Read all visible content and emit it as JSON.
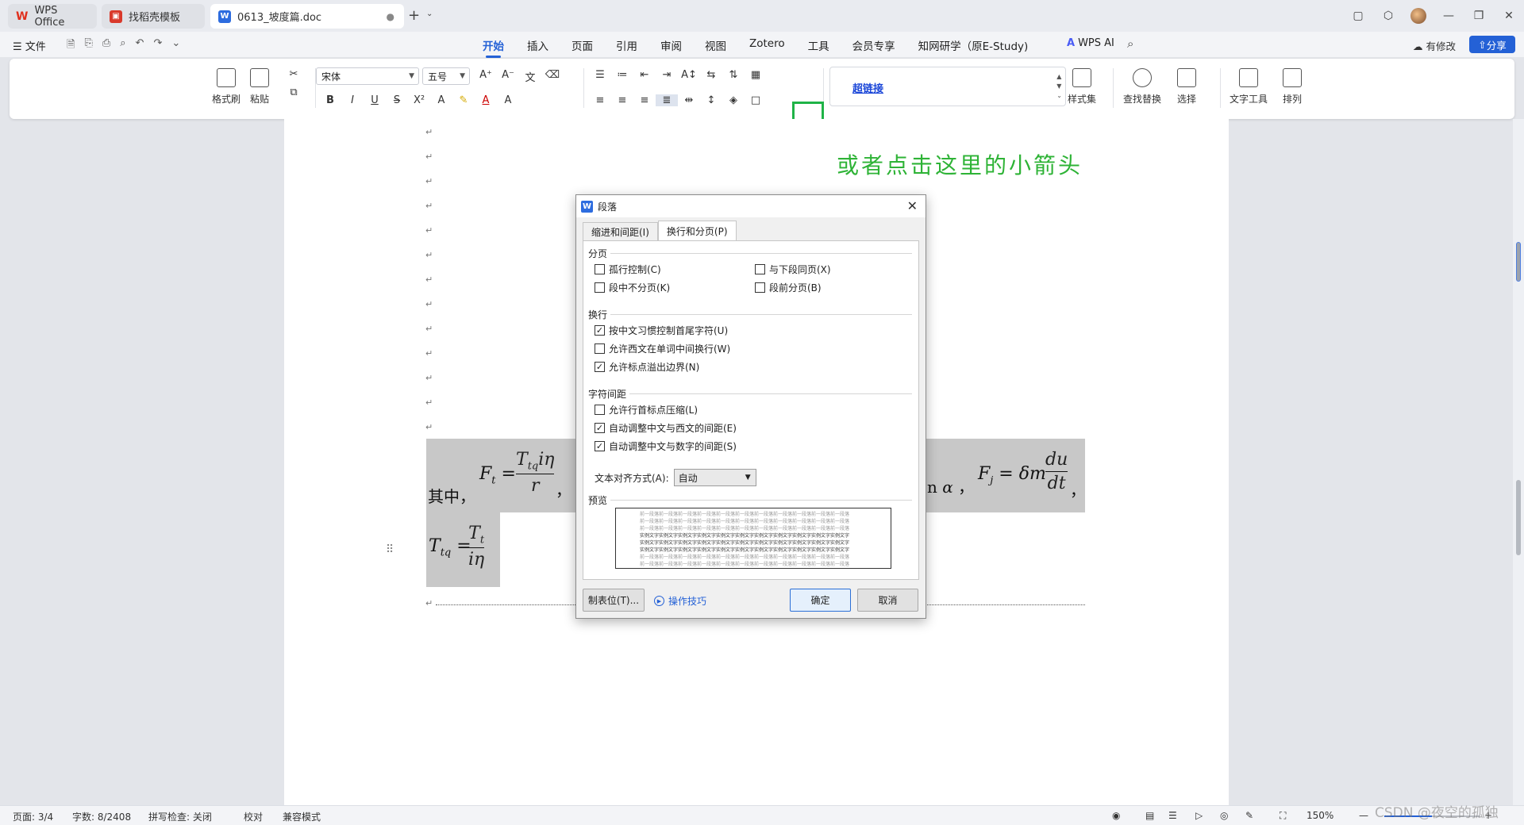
{
  "tabs": [
    {
      "label": "WPS Office"
    },
    {
      "label": "找稻壳模板"
    },
    {
      "label": "0613_坡度篇.doc"
    }
  ],
  "menu": {
    "file": "文件",
    "items": [
      "开始",
      "插入",
      "页面",
      "引用",
      "审阅",
      "视图",
      "Zotero",
      "工具",
      "会员专享",
      "知网研学（原E-Study)"
    ],
    "active": "开始",
    "wps_ai": "WPS AI",
    "modify": "有修改",
    "share": "分享"
  },
  "ribbon": {
    "format_painter": "格式刷",
    "paste": "粘贴",
    "font": "宋体",
    "font_size": "五号",
    "style_link": "超链接",
    "style_set": "样式集",
    "find_replace": "查找替换",
    "select": "选择",
    "text_tools": "文字工具",
    "arrange": "排列"
  },
  "annotation": "或者点击这里的小箭头",
  "document": {
    "lead_text": "其中，",
    "comma": "，"
  },
  "dialog": {
    "title": "段落",
    "tabs": [
      "缩进和间距(I)",
      "换行和分页(P)"
    ],
    "active_tab": "换行和分页(P)",
    "group_pagination": "分页",
    "widow_control": {
      "label": "孤行控制(C)",
      "checked": false
    },
    "keep_with_next": {
      "label": "与下段同页(X)",
      "checked": false
    },
    "keep_lines": {
      "label": "段中不分页(K)",
      "checked": false
    },
    "page_break_before": {
      "label": "段前分页(B)",
      "checked": false
    },
    "group_line_break": "换行",
    "cjk_rules": {
      "label": "按中文习惯控制首尾字符(U)",
      "checked": true
    },
    "word_wrap": {
      "label": "允许西文在单词中间换行(W)",
      "checked": false
    },
    "hanging_punct": {
      "label": "允许标点溢出边界(N)",
      "checked": true
    },
    "group_spacing": "字符间距",
    "compress_punct": {
      "label": "允许行首标点压缩(L)",
      "checked": false
    },
    "auto_space_latin": {
      "label": "自动调整中文与西文的间距(E)",
      "checked": true
    },
    "auto_space_digit": {
      "label": "自动调整中文与数字的间距(S)",
      "checked": true
    },
    "text_align_label": "文本对齐方式(A):",
    "text_align_value": "自动",
    "group_preview": "预览",
    "preview_prev": "前一段落前一段落前一段落前一段落前一段落前一段落前一段落前一段落前一段落前一段落前一段落",
    "preview_sample": "实例文字实例文字实例文字实例文字实例文字实例文字实例文字实例文字实例文字实例文字实例文字",
    "tab_button": "制表位(T)...",
    "tips": "操作技巧",
    "ok": "确定",
    "cancel": "取消"
  },
  "status": {
    "page": "页面: 3/4",
    "words": "字数: 8/2408",
    "spell": "拼写检查: 关闭",
    "proof": "校对",
    "compat": "兼容模式",
    "zoom": "150%"
  },
  "watermark": "CSDN @夜空的孤独",
  "colors": {
    "accent": "#2461d6",
    "annotation": "#2eb336",
    "highlight_box": "#1fb347"
  }
}
